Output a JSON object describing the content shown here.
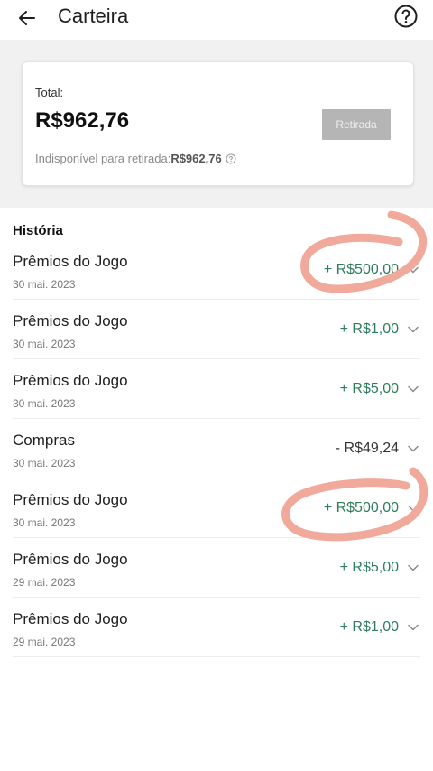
{
  "header": {
    "title": "Carteira",
    "back_icon": "arrow-left-icon",
    "help_icon": "question-circle-icon"
  },
  "wallet": {
    "total_label": "Total:",
    "total_value": "R$962,76",
    "withdraw_label": "Retirada",
    "unavailable_label": "Indisponível para retirada:",
    "unavailable_value": "R$962,76"
  },
  "history": {
    "title": "História",
    "items": [
      {
        "title": "Prêmios do Jogo",
        "date": "30 mai. 2023",
        "amount": "+ R$500,00",
        "positive": true
      },
      {
        "title": "Prêmios do Jogo",
        "date": "30 mai. 2023",
        "amount": "+ R$1,00",
        "positive": true
      },
      {
        "title": "Prêmios do Jogo",
        "date": "30 mai. 2023",
        "amount": "+ R$5,00",
        "positive": true
      },
      {
        "title": "Compras",
        "date": "30 mai. 2023",
        "amount": "- R$49,24",
        "positive": false
      },
      {
        "title": "Prêmios do Jogo",
        "date": "30 mai. 2023",
        "amount": "+ R$500,00",
        "positive": true
      },
      {
        "title": "Prêmios do Jogo",
        "date": "29 mai. 2023",
        "amount": "+ R$5,00",
        "positive": true
      },
      {
        "title": "Prêmios do Jogo",
        "date": "29 mai. 2023",
        "amount": "+ R$1,00",
        "positive": true
      }
    ]
  },
  "colors": {
    "positive": "#2f7d5e",
    "negative": "#333333",
    "annotation": "#f0a99a",
    "button_disabled": "#b5b5b5"
  }
}
